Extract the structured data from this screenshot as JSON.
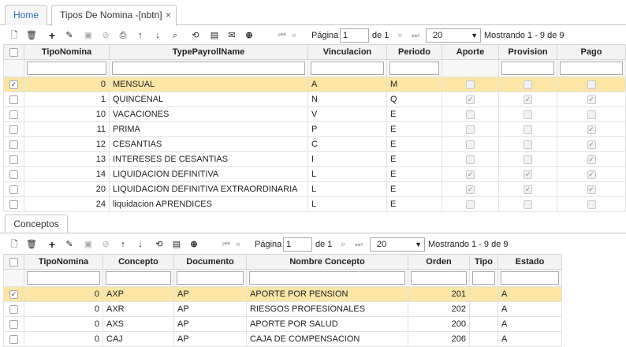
{
  "tabs": {
    "home": "Home",
    "active": "Tipos De Nomina -[nbtn]",
    "close": "×"
  },
  "pager_top": {
    "pagina": "Página",
    "page": "1",
    "de": "de 1",
    "size": "20",
    "status": "Mostrando 1 - 9 de 9"
  },
  "pager_bottom": {
    "pagina": "Página",
    "page": "1",
    "de": "de 1",
    "size": "20",
    "status": "Mostrando 1 - 9 de 9"
  },
  "top_headers": [
    "TipoNomina",
    "TypePayrollName",
    "Vinculacion",
    "Periodo",
    "Aporte",
    "Provision",
    "Pago"
  ],
  "top_rows": [
    {
      "id": "0",
      "name": "MENSUAL",
      "vinc": "A",
      "per": "M",
      "aporte": false,
      "provision": false,
      "pago": false,
      "selected": true
    },
    {
      "id": "1",
      "name": "QUINCENAL",
      "vinc": "N",
      "per": "Q",
      "aporte": true,
      "provision": true,
      "pago": true,
      "selected": false
    },
    {
      "id": "10",
      "name": "VACACIONES",
      "vinc": "V",
      "per": "E",
      "aporte": false,
      "provision": false,
      "pago": false,
      "selected": false
    },
    {
      "id": "11",
      "name": "PRIMA",
      "vinc": "P",
      "per": "E",
      "aporte": false,
      "provision": false,
      "pago": true,
      "selected": false
    },
    {
      "id": "12",
      "name": "CESANTIAS",
      "vinc": "C",
      "per": "E",
      "aporte": false,
      "provision": false,
      "pago": true,
      "selected": false
    },
    {
      "id": "13",
      "name": "INTERESES DE CESANTIAS",
      "vinc": "I",
      "per": "E",
      "aporte": false,
      "provision": false,
      "pago": true,
      "selected": false
    },
    {
      "id": "14",
      "name": "LIQUIDACION DEFINITIVA",
      "vinc": "L",
      "per": "E",
      "aporte": true,
      "provision": true,
      "pago": true,
      "selected": false
    },
    {
      "id": "20",
      "name": "LIQUIDACION DEFINITIVA EXTRAORDINARIA",
      "vinc": "L",
      "per": "E",
      "aporte": true,
      "provision": true,
      "pago": true,
      "selected": false
    },
    {
      "id": "24",
      "name": "liquidacion APRENDICES",
      "vinc": "L",
      "per": "E",
      "aporte": false,
      "provision": false,
      "pago": false,
      "selected": false
    }
  ],
  "conceptos_tab": "Conceptos",
  "bottom_headers": [
    "TipoNomina",
    "Concepto",
    "Documento",
    "Nombre Concepto",
    "Orden",
    "Tipo",
    "Estado"
  ],
  "bottom_rows": [
    {
      "id": "0",
      "concepto": "AXP",
      "doc": "AP",
      "nombre": "APORTE POR PENSION",
      "orden": "201",
      "tipo": "",
      "estado": "A",
      "selected": true
    },
    {
      "id": "0",
      "concepto": "AXR",
      "doc": "AP",
      "nombre": "RIESGOS PROFESIONALES",
      "orden": "202",
      "tipo": "",
      "estado": "A",
      "selected": false
    },
    {
      "id": "0",
      "concepto": "AXS",
      "doc": "AP",
      "nombre": "APORTE POR SALUD",
      "orden": "200",
      "tipo": "",
      "estado": "A",
      "selected": false
    },
    {
      "id": "0",
      "concepto": "CAJ",
      "doc": "AP",
      "nombre": "CAJA DE COMPENSACION",
      "orden": "206",
      "tipo": "",
      "estado": "A",
      "selected": false
    }
  ],
  "colors": {
    "selected_row": "#fbe6a6",
    "link": "#2a6db5"
  }
}
